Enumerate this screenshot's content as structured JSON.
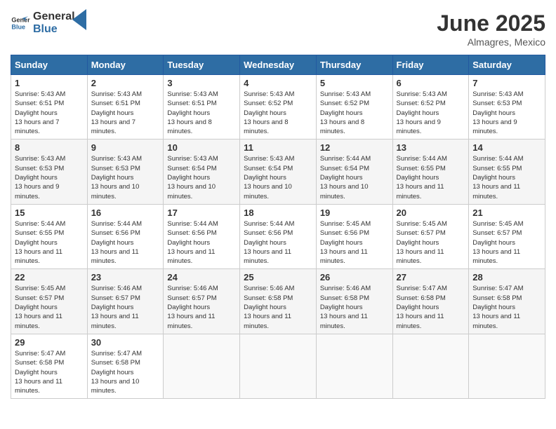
{
  "header": {
    "logo_general": "General",
    "logo_blue": "Blue",
    "month_year": "June 2025",
    "location": "Almagres, Mexico"
  },
  "weekdays": [
    "Sunday",
    "Monday",
    "Tuesday",
    "Wednesday",
    "Thursday",
    "Friday",
    "Saturday"
  ],
  "weeks": [
    [
      {
        "day": "1",
        "sunrise": "5:43 AM",
        "sunset": "6:51 PM",
        "daylight": "13 hours and 7 minutes."
      },
      {
        "day": "2",
        "sunrise": "5:43 AM",
        "sunset": "6:51 PM",
        "daylight": "13 hours and 7 minutes."
      },
      {
        "day": "3",
        "sunrise": "5:43 AM",
        "sunset": "6:51 PM",
        "daylight": "13 hours and 8 minutes."
      },
      {
        "day": "4",
        "sunrise": "5:43 AM",
        "sunset": "6:52 PM",
        "daylight": "13 hours and 8 minutes."
      },
      {
        "day": "5",
        "sunrise": "5:43 AM",
        "sunset": "6:52 PM",
        "daylight": "13 hours and 8 minutes."
      },
      {
        "day": "6",
        "sunrise": "5:43 AM",
        "sunset": "6:52 PM",
        "daylight": "13 hours and 9 minutes."
      },
      {
        "day": "7",
        "sunrise": "5:43 AM",
        "sunset": "6:53 PM",
        "daylight": "13 hours and 9 minutes."
      }
    ],
    [
      {
        "day": "8",
        "sunrise": "5:43 AM",
        "sunset": "6:53 PM",
        "daylight": "13 hours and 9 minutes."
      },
      {
        "day": "9",
        "sunrise": "5:43 AM",
        "sunset": "6:53 PM",
        "daylight": "13 hours and 10 minutes."
      },
      {
        "day": "10",
        "sunrise": "5:43 AM",
        "sunset": "6:54 PM",
        "daylight": "13 hours and 10 minutes."
      },
      {
        "day": "11",
        "sunrise": "5:43 AM",
        "sunset": "6:54 PM",
        "daylight": "13 hours and 10 minutes."
      },
      {
        "day": "12",
        "sunrise": "5:44 AM",
        "sunset": "6:54 PM",
        "daylight": "13 hours and 10 minutes."
      },
      {
        "day": "13",
        "sunrise": "5:44 AM",
        "sunset": "6:55 PM",
        "daylight": "13 hours and 11 minutes."
      },
      {
        "day": "14",
        "sunrise": "5:44 AM",
        "sunset": "6:55 PM",
        "daylight": "13 hours and 11 minutes."
      }
    ],
    [
      {
        "day": "15",
        "sunrise": "5:44 AM",
        "sunset": "6:55 PM",
        "daylight": "13 hours and 11 minutes."
      },
      {
        "day": "16",
        "sunrise": "5:44 AM",
        "sunset": "6:56 PM",
        "daylight": "13 hours and 11 minutes."
      },
      {
        "day": "17",
        "sunrise": "5:44 AM",
        "sunset": "6:56 PM",
        "daylight": "13 hours and 11 minutes."
      },
      {
        "day": "18",
        "sunrise": "5:44 AM",
        "sunset": "6:56 PM",
        "daylight": "13 hours and 11 minutes."
      },
      {
        "day": "19",
        "sunrise": "5:45 AM",
        "sunset": "6:56 PM",
        "daylight": "13 hours and 11 minutes."
      },
      {
        "day": "20",
        "sunrise": "5:45 AM",
        "sunset": "6:57 PM",
        "daylight": "13 hours and 11 minutes."
      },
      {
        "day": "21",
        "sunrise": "5:45 AM",
        "sunset": "6:57 PM",
        "daylight": "13 hours and 11 minutes."
      }
    ],
    [
      {
        "day": "22",
        "sunrise": "5:45 AM",
        "sunset": "6:57 PM",
        "daylight": "13 hours and 11 minutes."
      },
      {
        "day": "23",
        "sunrise": "5:46 AM",
        "sunset": "6:57 PM",
        "daylight": "13 hours and 11 minutes."
      },
      {
        "day": "24",
        "sunrise": "5:46 AM",
        "sunset": "6:57 PM",
        "daylight": "13 hours and 11 minutes."
      },
      {
        "day": "25",
        "sunrise": "5:46 AM",
        "sunset": "6:58 PM",
        "daylight": "13 hours and 11 minutes."
      },
      {
        "day": "26",
        "sunrise": "5:46 AM",
        "sunset": "6:58 PM",
        "daylight": "13 hours and 11 minutes."
      },
      {
        "day": "27",
        "sunrise": "5:47 AM",
        "sunset": "6:58 PM",
        "daylight": "13 hours and 11 minutes."
      },
      {
        "day": "28",
        "sunrise": "5:47 AM",
        "sunset": "6:58 PM",
        "daylight": "13 hours and 11 minutes."
      }
    ],
    [
      {
        "day": "29",
        "sunrise": "5:47 AM",
        "sunset": "6:58 PM",
        "daylight": "13 hours and 11 minutes."
      },
      {
        "day": "30",
        "sunrise": "5:47 AM",
        "sunset": "6:58 PM",
        "daylight": "13 hours and 10 minutes."
      },
      {
        "day": "",
        "sunrise": "",
        "sunset": "",
        "daylight": ""
      },
      {
        "day": "",
        "sunrise": "",
        "sunset": "",
        "daylight": ""
      },
      {
        "day": "",
        "sunrise": "",
        "sunset": "",
        "daylight": ""
      },
      {
        "day": "",
        "sunrise": "",
        "sunset": "",
        "daylight": ""
      },
      {
        "day": "",
        "sunrise": "",
        "sunset": "",
        "daylight": ""
      }
    ]
  ]
}
